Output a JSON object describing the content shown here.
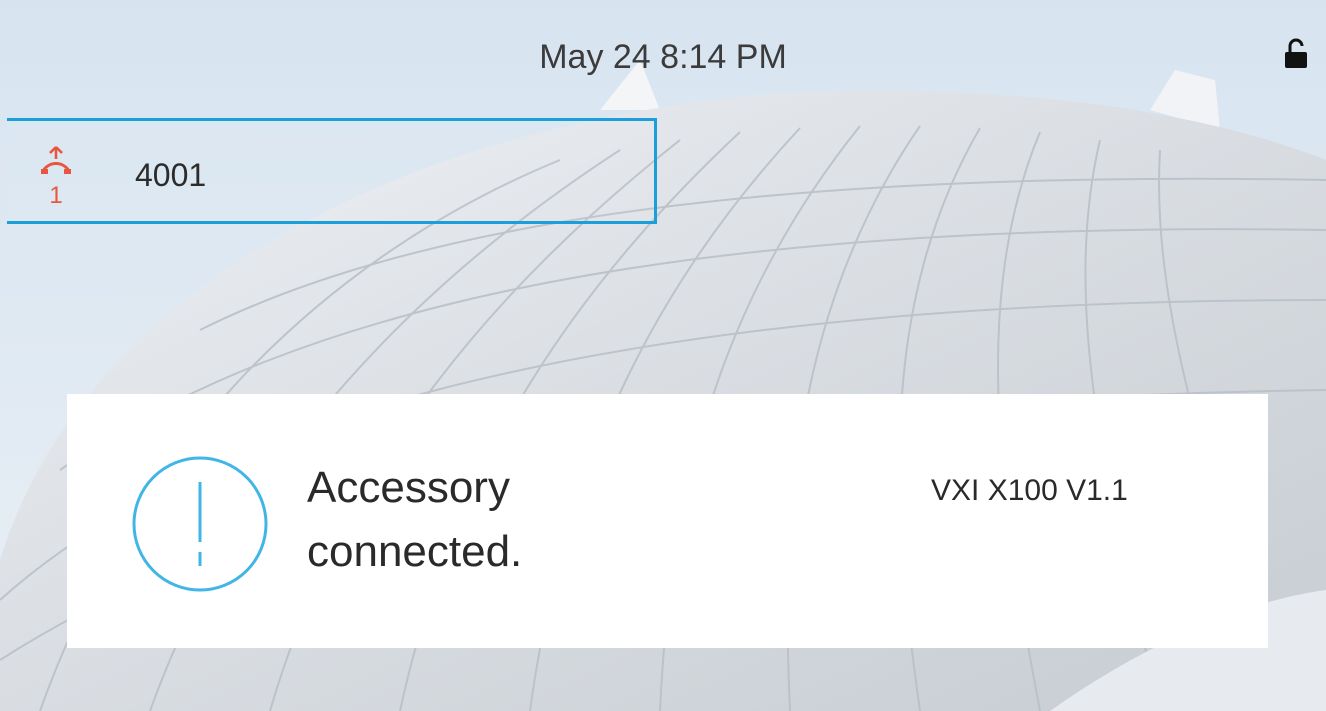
{
  "status_bar": {
    "datetime": "May 24 8:14 PM",
    "lock_icon": "unlocked-padlock-icon"
  },
  "line_key": {
    "label": "4001",
    "icon": "line-status-icon",
    "icon_number": "1",
    "icon_color": "#e8563f",
    "border_color": "#1a9fd8"
  },
  "notification": {
    "icon": "alert-icon",
    "icon_color": "#41b6e6",
    "message": "Accessory connected.",
    "detail": "VXI X100 V1.1"
  }
}
